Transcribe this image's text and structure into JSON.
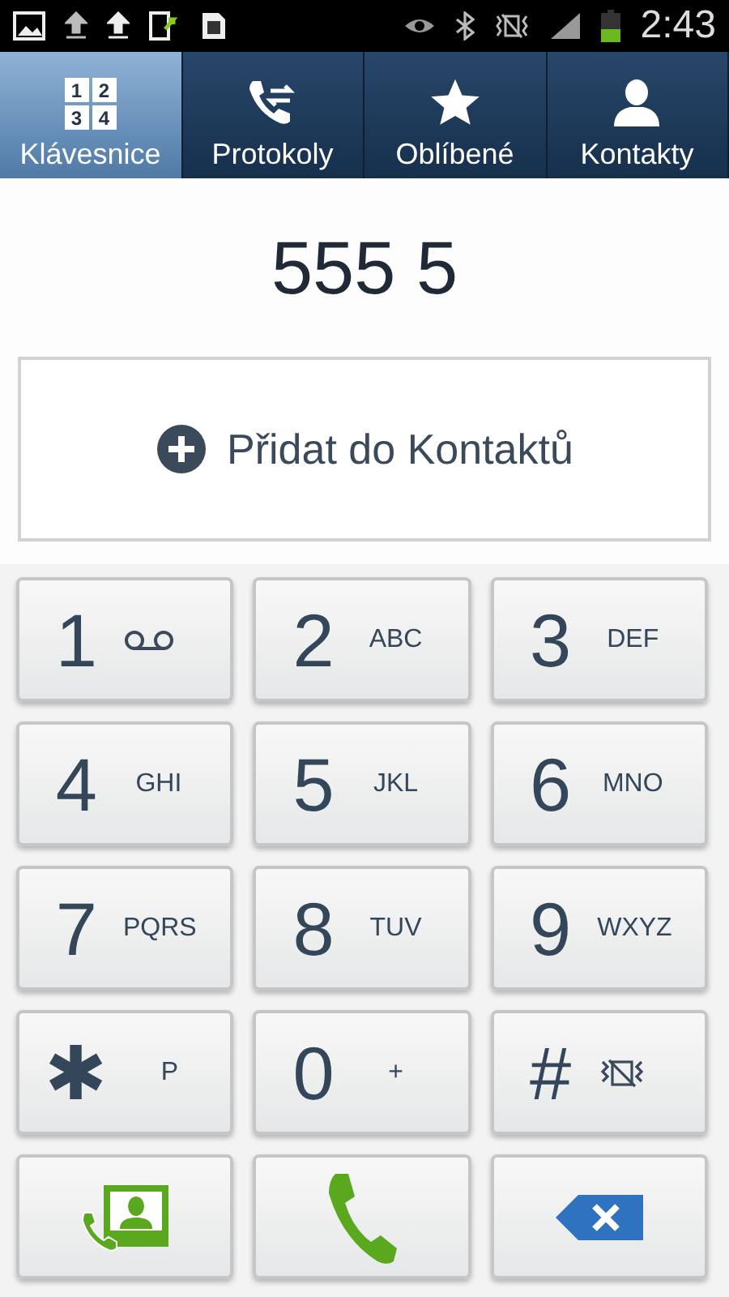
{
  "status_bar": {
    "time": "2:43"
  },
  "tabs": [
    {
      "label": "Klávesnice",
      "kind": "keypad",
      "icon_digits": [
        "1",
        "2",
        "3",
        "4"
      ],
      "selected": true
    },
    {
      "label": "Protokoly",
      "kind": "log",
      "selected": false
    },
    {
      "label": "Oblíbené",
      "kind": "star",
      "selected": false
    },
    {
      "label": "Kontakty",
      "kind": "person",
      "selected": false
    }
  ],
  "number": "555 5",
  "add_button": {
    "label": "Přidat do Kontaktů"
  },
  "keys": [
    {
      "kind": "digit-voicemail",
      "main": "1"
    },
    {
      "kind": "digit",
      "main": "2",
      "sub": "ABC"
    },
    {
      "kind": "digit",
      "main": "3",
      "sub": "DEF"
    },
    {
      "kind": "digit",
      "main": "4",
      "sub": "GHI"
    },
    {
      "kind": "digit",
      "main": "5",
      "sub": "JKL"
    },
    {
      "kind": "digit",
      "main": "6",
      "sub": "MNO"
    },
    {
      "kind": "digit",
      "main": "7",
      "sub": "PQRS"
    },
    {
      "kind": "digit",
      "main": "8",
      "sub": "TUV"
    },
    {
      "kind": "digit",
      "main": "9",
      "sub": "WXYZ"
    },
    {
      "kind": "digit",
      "main": "✱",
      "sub": "P"
    },
    {
      "kind": "digit",
      "main": "0",
      "sub": "+"
    },
    {
      "kind": "digit-mute",
      "main": "#"
    },
    {
      "kind": "contacts"
    },
    {
      "kind": "call"
    },
    {
      "kind": "backspace"
    }
  ]
}
